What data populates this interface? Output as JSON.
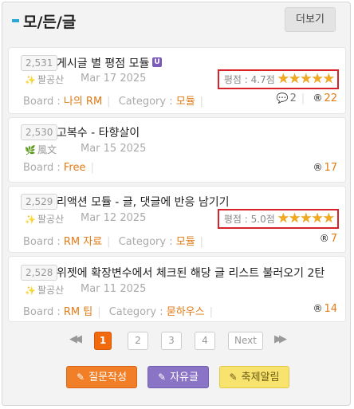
{
  "header": {
    "title": "모/든/글",
    "more_label": "더보기"
  },
  "labels": {
    "board": "Board : ",
    "category": "Category : ",
    "rating_prefix": "평점 : "
  },
  "posts": [
    {
      "number": "2,531",
      "title": "게시글 별 평점 모듈",
      "badge": "U",
      "author": "팔공산",
      "author_avatar": "sparkle-avatar-icon",
      "date": "Mar 17 2025",
      "rating": "4.7점",
      "stars": 5,
      "board": "나의 RM",
      "category": "모듈",
      "comments": "2",
      "views": "22"
    },
    {
      "number": "2,530",
      "title": "고복수 - 타향살이",
      "author": "風文",
      "author_avatar": "plant-avatar-icon",
      "date": "Mar 15 2025",
      "board": "Free",
      "views": "17"
    },
    {
      "number": "2,529",
      "title": "리액션 모듈 - 글, 댓글에 반응 남기기",
      "author": "팔공산",
      "author_avatar": "sparkle-avatar-icon",
      "date": "Mar 12 2025",
      "rating": "5.0점",
      "stars": 5,
      "board": "RM 자료",
      "category": "모듈",
      "views": "7"
    },
    {
      "number": "2,528",
      "title": "위젯에 확장변수에서 체크된 해당 글 리스트 불러오기 2탄",
      "author": "팔공산",
      "author_avatar": "sparkle-avatar-icon",
      "date": "Mar 11 2025",
      "board": "RM 팁",
      "category": "묻하우스",
      "views": "14"
    }
  ],
  "pagination": {
    "pages": [
      "1",
      "2",
      "3",
      "4"
    ],
    "active": "1",
    "next_label": "Next"
  },
  "actions": {
    "question": "질문작성",
    "free": "자유글",
    "festival": "축제알림"
  },
  "colors": {
    "accent": "#2ba7d8",
    "orange": "#f26a0e",
    "star": "#f2a922",
    "highlight_border": "#d8232a"
  }
}
